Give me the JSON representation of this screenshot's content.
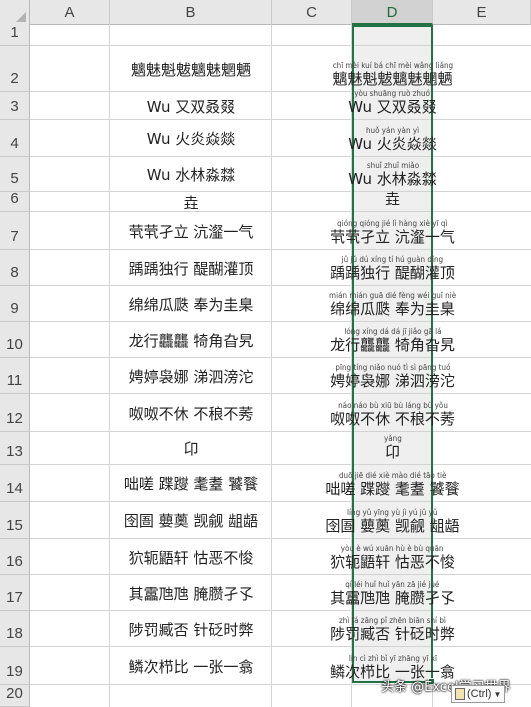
{
  "columns": [
    "A",
    "B",
    "C",
    "D",
    "E"
  ],
  "selected_column": "D",
  "rows": [
    {
      "num": "1"
    },
    {
      "num": "2",
      "b": "魑魅魁魃魑魅魍魉",
      "d_pinyin": "chī mèi kuí bá chī mèi wǎng liǎng",
      "d": "魑魅魁魃魑魅魍魉"
    },
    {
      "num": "3",
      "b": "Wu 又双叒叕",
      "d_pinyin": "yòu shuāng ruò zhuó",
      "d": "Wu 又双叒叕"
    },
    {
      "num": "4",
      "b": "Wu 火炎焱燚",
      "d_pinyin": "huǒ yán yàn yì",
      "d": "Wu 火炎焱燚"
    },
    {
      "num": "5",
      "b": "Wu 水林淼㵘",
      "d_pinyin": "shuǐ zhuǐ miǎo",
      "d": "Wu 水林淼㵘"
    },
    {
      "num": "6",
      "b": "垚",
      "d_pinyin": "",
      "d": "垚"
    },
    {
      "num": "7",
      "b": "茕茕孑立 沆瀣一气",
      "d_pinyin": "qióng qióng jié lì hàng xiè yī qì",
      "d": "茕茕孑立 沆瀣一气"
    },
    {
      "num": "8",
      "b": "踽踽独行 醍醐灌顶",
      "d_pinyin": "jǔ jǔ dú xíng tí hú guàn dǐng",
      "d": "踽踽独行 醍醐灌顶"
    },
    {
      "num": "9",
      "b": "绵绵瓜瓞 奉为圭臬",
      "d_pinyin": "mián mián guā dié fèng wéi guī niè",
      "d": "绵绵瓜瓞 奉为圭臬"
    },
    {
      "num": "10",
      "b": "龙行龘龘 犄角旮旯",
      "d_pinyin": "lóng xíng dá dá jī jiǎo gā lá",
      "d": "龙行龘龘 犄角旮旯"
    },
    {
      "num": "11",
      "b": "娉婷袅娜 涕泗滂沱",
      "d_pinyin": "pīng tíng niǎo nuó tì sì pāng tuó",
      "d": "娉婷袅娜 涕泗滂沱"
    },
    {
      "num": "12",
      "b": "呶呶不休 不稂不莠",
      "d_pinyin": "náo náo bù xiū bù láng bù yǒu",
      "d": "呶呶不休 不稂不莠"
    },
    {
      "num": "13",
      "b": "卬",
      "d_pinyin": "yǎng",
      "d": "卬"
    },
    {
      "num": "14",
      "b": "咄嗟 蹀躞 耄耋 饕餮",
      "d_pinyin": "duō jiē dié xiè mào dié tāo tiè",
      "d": "咄嗟 蹀躞 耄耋 饕餮"
    },
    {
      "num": "15",
      "b": "囹圄 蘡薁 觊觎 龃龉",
      "d_pinyin": "líng yǔ yīng yù jì yú jǔ yǔ",
      "d": "囹圄 蘡薁 觊觎 龃龉"
    },
    {
      "num": "16",
      "b": "狖轭鼯轩 怙恶不悛",
      "d_pinyin": "yòu è wú xuān hù è bù quān",
      "d": "狖轭鼯轩 怙恶不悛"
    },
    {
      "num": "17",
      "b": "其靁虺虺 腌臜孑孓",
      "d_pinyin": "qí léi huǐ huǐ yān zā jié jué",
      "d": "其靁虺虺 腌臜孑孓"
    },
    {
      "num": "18",
      "b": "陟罚臧否 针砭时弊",
      "d_pinyin": "zhì fá zāng pǐ zhēn biān shí bì",
      "d": "陟罚臧否 针砭时弊"
    },
    {
      "num": "19",
      "b": "鳞次栉比 一张一翕",
      "d_pinyin": "lín cì zhì bǐ yī zhāng yī xī",
      "d": "鳞次栉比 一张一翕"
    },
    {
      "num": "20"
    }
  ],
  "paste_options_label": "(Ctrl)",
  "watermark": "头条 @Excel学习世界",
  "colors": {
    "selection": "#217346",
    "header_bg": "#e7e7e7",
    "grid": "#d4d4d4"
  }
}
